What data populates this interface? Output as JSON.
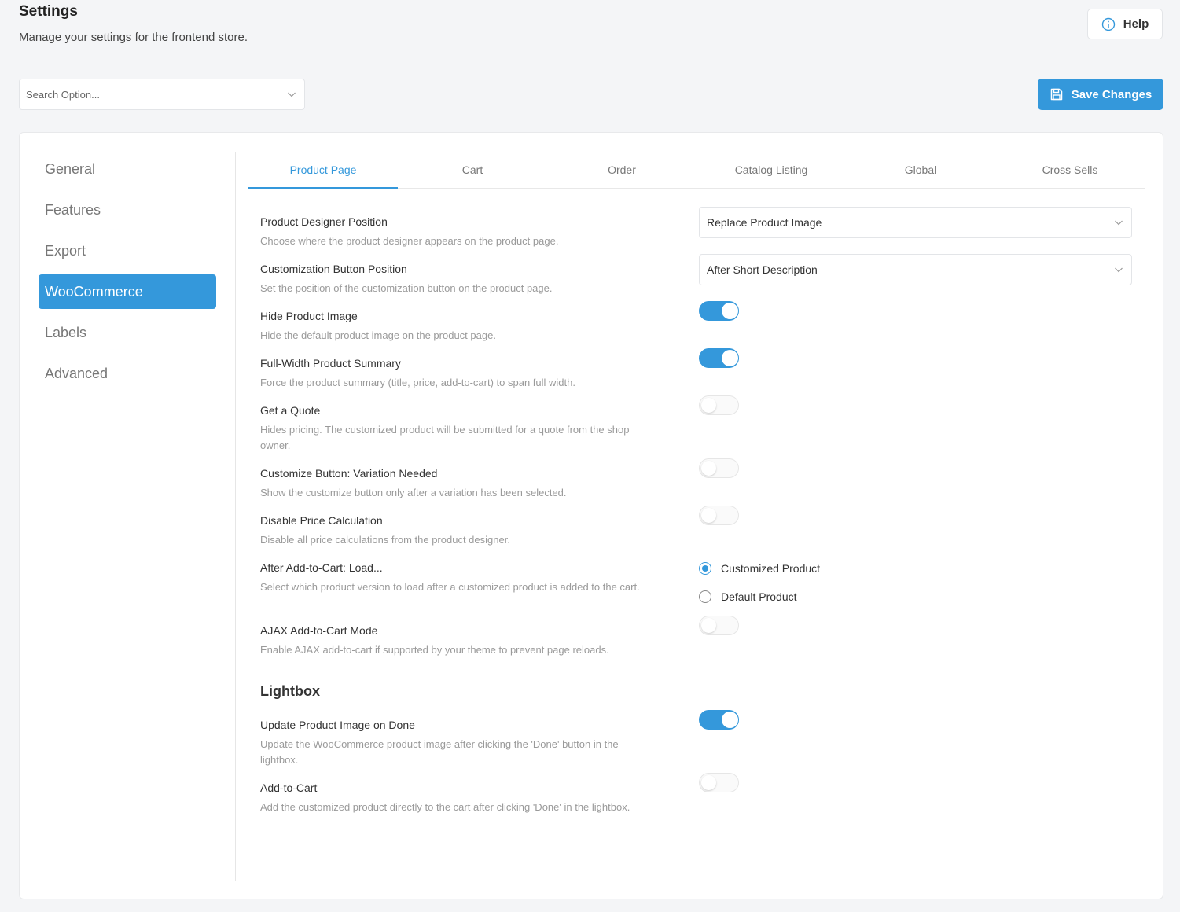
{
  "header": {
    "title": "Settings",
    "subtitle": "Manage your settings for the frontend store.",
    "help_label": "Help",
    "help_icon": "info-circle-icon"
  },
  "search": {
    "placeholder": "Search Option...",
    "icon": "chevron-down-icon"
  },
  "toolbar": {
    "save_label": "Save Changes",
    "save_icon": "floppy-disk-icon"
  },
  "colors": {
    "accent": "#3498db",
    "background": "#f4f5f7"
  },
  "sidebar": {
    "items": [
      {
        "label": "General",
        "active": false
      },
      {
        "label": "Features",
        "active": false
      },
      {
        "label": "Export",
        "active": false
      },
      {
        "label": "WooCommerce",
        "active": true
      },
      {
        "label": "Labels",
        "active": false
      },
      {
        "label": "Advanced",
        "active": false
      }
    ]
  },
  "tabs": [
    {
      "label": "Product Page",
      "active": true
    },
    {
      "label": "Cart",
      "active": false
    },
    {
      "label": "Order",
      "active": false
    },
    {
      "label": "Catalog Listing",
      "active": false
    },
    {
      "label": "Global",
      "active": false
    },
    {
      "label": "Cross Sells",
      "active": false
    }
  ],
  "options": {
    "designer_position": {
      "label": "Product Designer Position",
      "desc": "Choose where the product designer appears on the product page.",
      "value": "Replace Product Image"
    },
    "button_position": {
      "label": "Customization Button Position",
      "desc": "Set the position of the customization button on the product page.",
      "value": "After Short Description"
    },
    "hide_image": {
      "label": "Hide Product Image",
      "desc": "Hide the default product image on the product page.",
      "enabled": true
    },
    "full_width": {
      "label": "Full-Width Product Summary",
      "desc": "Force the product summary (title, price, add-to-cart) to span full width.",
      "enabled": true
    },
    "get_quote": {
      "label": "Get a Quote",
      "desc": "Hides pricing. The customized product will be submitted for a quote from the shop owner.",
      "enabled": false
    },
    "variation_needed": {
      "label": "Customize Button: Variation Needed",
      "desc": "Show the customize button only after a variation has been selected.",
      "enabled": false
    },
    "disable_price": {
      "label": "Disable Price Calculation",
      "desc": "Disable all price calculations from the product designer.",
      "enabled": false
    },
    "after_add_to_cart": {
      "label": "After Add-to-Cart: Load...",
      "desc": "Select which product version to load after a customized product is added to the cart.",
      "choices": [
        "Customized Product",
        "Default Product"
      ],
      "selected": "Customized Product"
    },
    "ajax_cart": {
      "label": "AJAX Add-to-Cart Mode",
      "desc": "Enable AJAX add-to-cart if supported by your theme to prevent page reloads.",
      "enabled": false
    }
  },
  "lightbox": {
    "title": "Lightbox",
    "update_image": {
      "label": "Update Product Image on Done",
      "desc": "Update the WooCommerce product image after clicking the 'Done' button in the lightbox.",
      "enabled": true
    },
    "add_to_cart": {
      "label": "Add-to-Cart",
      "desc": "Add the customized product directly to the cart after clicking 'Done' in the lightbox.",
      "enabled": false
    }
  }
}
